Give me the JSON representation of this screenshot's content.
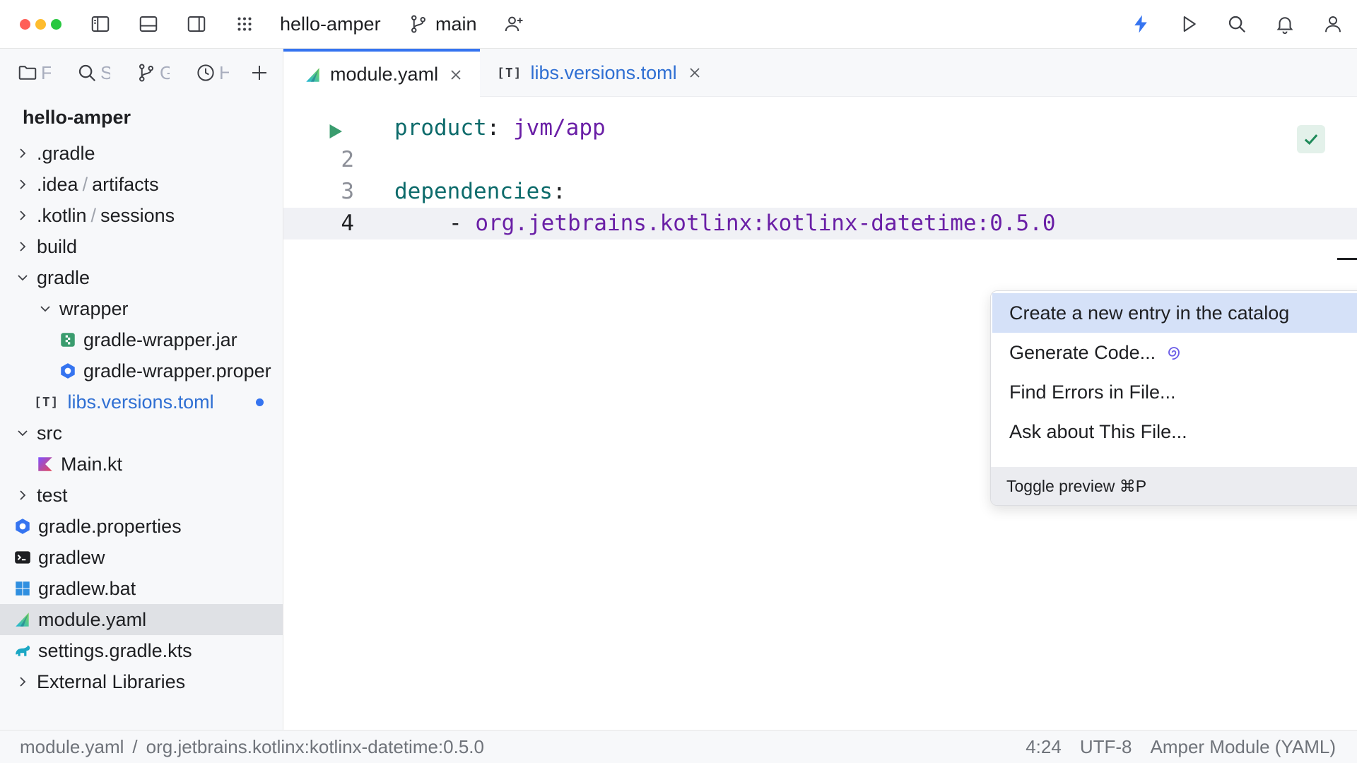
{
  "window": {
    "traffic_colors": [
      "#ff5f57",
      "#febc2e",
      "#28c840"
    ],
    "project_name": "hello-amper",
    "branch": "main",
    "accent": "#3574f0"
  },
  "toolbar": {
    "left_icons": [
      "sidebar-left-icon",
      "bottom-panel-icon",
      "sidebar-right-icon",
      "apps-grid-icon"
    ],
    "right_icons": [
      "lightning-icon",
      "run-icon",
      "search-icon",
      "bell-icon",
      "user-icon"
    ],
    "invite_icon": "add-user-icon"
  },
  "sidebar": {
    "tabs": [
      {
        "icon": "folder-icon",
        "label": "F"
      },
      {
        "icon": "search-icon",
        "label": "S"
      },
      {
        "icon": "branch-icon",
        "label": "G"
      },
      {
        "icon": "clock-icon",
        "label": "H"
      }
    ],
    "add_icon": "plus-icon",
    "project_title": "hello-amper",
    "tree": [
      {
        "label": ".gradle",
        "expanded": false
      },
      {
        "label": ".idea",
        "sub": "artifacts",
        "expanded": false
      },
      {
        "label": ".kotlin",
        "sub": "sessions",
        "expanded": false
      },
      {
        "label": "build",
        "expanded": false
      },
      {
        "label": "gradle",
        "expanded": true
      },
      {
        "label": "wrapper",
        "expanded": true
      },
      {
        "label": "gradle-wrapper.jar",
        "icon": "jar-icon"
      },
      {
        "label": "gradle-wrapper.proper",
        "icon": "properties-icon"
      },
      {
        "label": "libs.versions.toml",
        "badge": "[T]",
        "modified": true
      },
      {
        "label": "src",
        "expanded": true
      },
      {
        "label": "Main.kt",
        "icon": "kotlin-icon"
      },
      {
        "label": "test",
        "expanded": false
      },
      {
        "label": "gradle.properties",
        "icon": "properties-icon"
      },
      {
        "label": "gradlew",
        "icon": "terminal-icon"
      },
      {
        "label": "gradlew.bat",
        "icon": "windows-icon"
      },
      {
        "label": "module.yaml",
        "icon": "amper-icon",
        "selected": true
      },
      {
        "label": "settings.gradle.kts",
        "icon": "gradle-elephant-icon"
      },
      {
        "label": "External Libraries",
        "expanded": false
      }
    ]
  },
  "editor": {
    "tabs": [
      {
        "label": "module.yaml",
        "active": true
      },
      {
        "label": "libs.versions.toml",
        "badge": "[T]",
        "active": false
      }
    ],
    "lines": [
      {
        "num": "",
        "key": "product",
        "colon": ":",
        "value": "jvm/app"
      },
      {
        "num": "2"
      },
      {
        "num": "3",
        "key": "dependencies",
        "colon": ":"
      },
      {
        "num": "4",
        "dash": "- ",
        "value": "org.jetbrains.kotlinx:kotlinx-datetime:0.5.0"
      }
    ],
    "syntax_colors": {
      "key": "#0d6b6b",
      "value": "#6a1fa6"
    }
  },
  "popup": {
    "items": [
      {
        "label": "Create a new entry in the catalog",
        "active": true
      },
      {
        "label": "Generate Code...",
        "icon": "ai-spiral-icon"
      },
      {
        "label": "Find Errors in File..."
      },
      {
        "label": "Ask about This File..."
      }
    ],
    "footer": "Toggle preview ⌘P"
  },
  "status": {
    "crumbs": [
      "module.yaml",
      "org.jetbrains.kotlinx:kotlinx-datetime:0.5.0"
    ],
    "crumb_sep": "/",
    "position": "4:24",
    "encoding": "UTF-8",
    "file_type": "Amper Module (YAML)"
  }
}
